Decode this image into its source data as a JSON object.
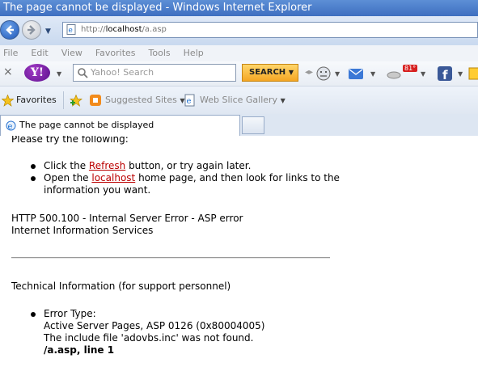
{
  "window": {
    "title": "The page cannot be displayed - Windows Internet Explorer"
  },
  "address": {
    "url_prefix": "http://",
    "url_host": "localhost",
    "url_path": "/a.asp"
  },
  "menu": [
    "File",
    "Edit",
    "View",
    "Favorites",
    "Tools",
    "Help"
  ],
  "yahoo": {
    "close": "×",
    "logo": "Y!",
    "search_placeholder": "Yahoo! Search",
    "search_button": "SEARCH",
    "weather_badge": "81°"
  },
  "favorites": {
    "label": "Favorites",
    "suggested": "Suggested Sites",
    "webslice": "Web Slice Gallery"
  },
  "tab": {
    "label": "The page cannot be displayed"
  },
  "content": {
    "try_line": "Please try the following:",
    "item1_pre": "Click the ",
    "item1_link": "Refresh",
    "item1_post": " button, or try again later.",
    "item2_pre": "Open the ",
    "item2_link": "localhost",
    "item2_post": " home page, and then look for links to the",
    "item2_line2": "information you want.",
    "error_line1": "HTTP 500.100 - Internal Server Error - ASP error",
    "error_line2": "Internet Information Services",
    "tech_title": "Technical Information (for support personnel)",
    "error_type_label": "Error Type:",
    "error_type_line1": "Active Server Pages, ASP 0126 (0x80004005)",
    "error_type_line2": "The include file 'adovbs.inc' was not found.",
    "error_type_line3": "/a.asp, line 1"
  },
  "colors": {
    "link": "#bb0000",
    "titlebar": "#3e6fc0",
    "search_button": "#f5a623"
  }
}
